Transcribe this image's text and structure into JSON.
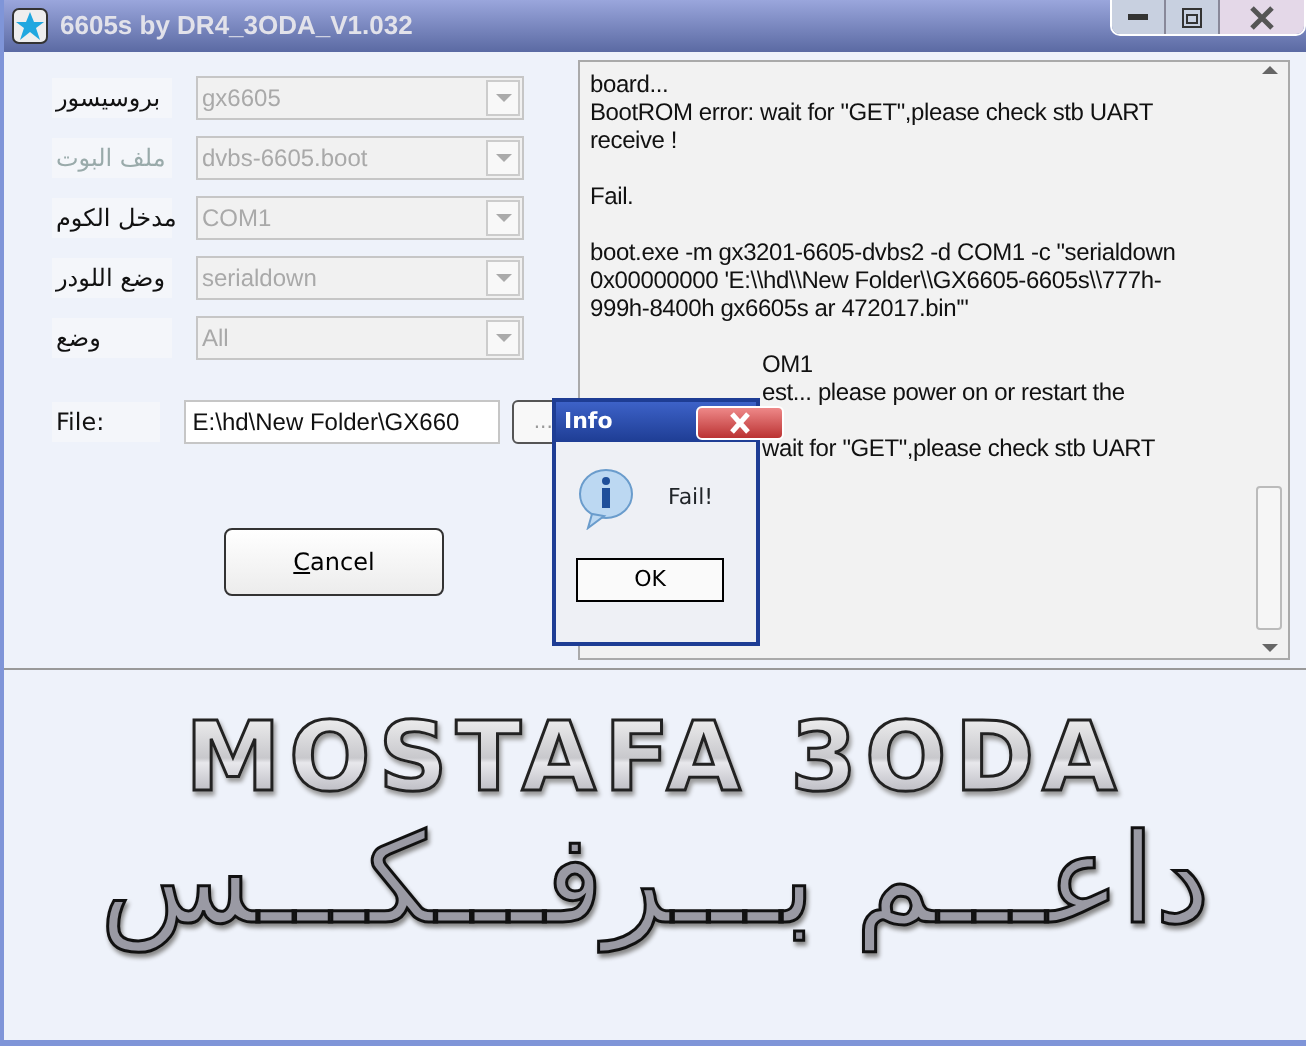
{
  "window": {
    "title": "6605s by DR4_3ODA_V1.032"
  },
  "form": {
    "fields": [
      {
        "label": "بروسيسور",
        "value": "gx6605",
        "disabled": true,
        "label_faded": false
      },
      {
        "label": "ملف البوت",
        "value": "dvbs-6605.boot",
        "disabled": true,
        "label_faded": true
      },
      {
        "label": "مدخل الكوم",
        "value": "COM1",
        "disabled": true,
        "label_faded": false
      },
      {
        "label": "وضع اللودر",
        "value": "serialdown",
        "disabled": true,
        "label_faded": false
      },
      {
        "label": "وضع",
        "value": "All",
        "disabled": true,
        "label_faded": false
      }
    ],
    "file": {
      "label": "File:",
      "value": "E:\\hd\\New Folder\\GX660",
      "browse": "..."
    },
    "cancel": "Cancel"
  },
  "log": {
    "lines": [
      {
        "kind": "line",
        "text": "board..."
      },
      {
        "kind": "line",
        "text": "BootROM error: wait for \"GET\",please check stb UART"
      },
      {
        "kind": "line",
        "text": "receive !"
      },
      {
        "kind": "blank"
      },
      {
        "kind": "line",
        "text": "Fail."
      },
      {
        "kind": "blank"
      },
      {
        "kind": "line",
        "text": "boot.exe -m gx3201-6605-dvbs2 -d COM1 -c \"serialdown"
      },
      {
        "kind": "line",
        "text": "0x00000000 'E:\\\\hd\\\\New Folder\\\\GX6605-6605s\\\\777h-"
      },
      {
        "kind": "line",
        "text": "999h-8400h gx6605s ar 472017.bin'\""
      },
      {
        "kind": "blank"
      },
      {
        "kind": "covered",
        "text": "OM1"
      },
      {
        "kind": "covered",
        "text": "est... please power on or restart the"
      },
      {
        "kind": "blank"
      },
      {
        "kind": "covered",
        "text": "wait for \"GET\",please check stb UART"
      }
    ]
  },
  "dialog": {
    "title": "Info",
    "message": "Fail!",
    "button": "OK"
  },
  "banner": {
    "title": "MOSTAFA 3ODA",
    "subtitle": "داعـــم بـــرفـــكـــس"
  }
}
